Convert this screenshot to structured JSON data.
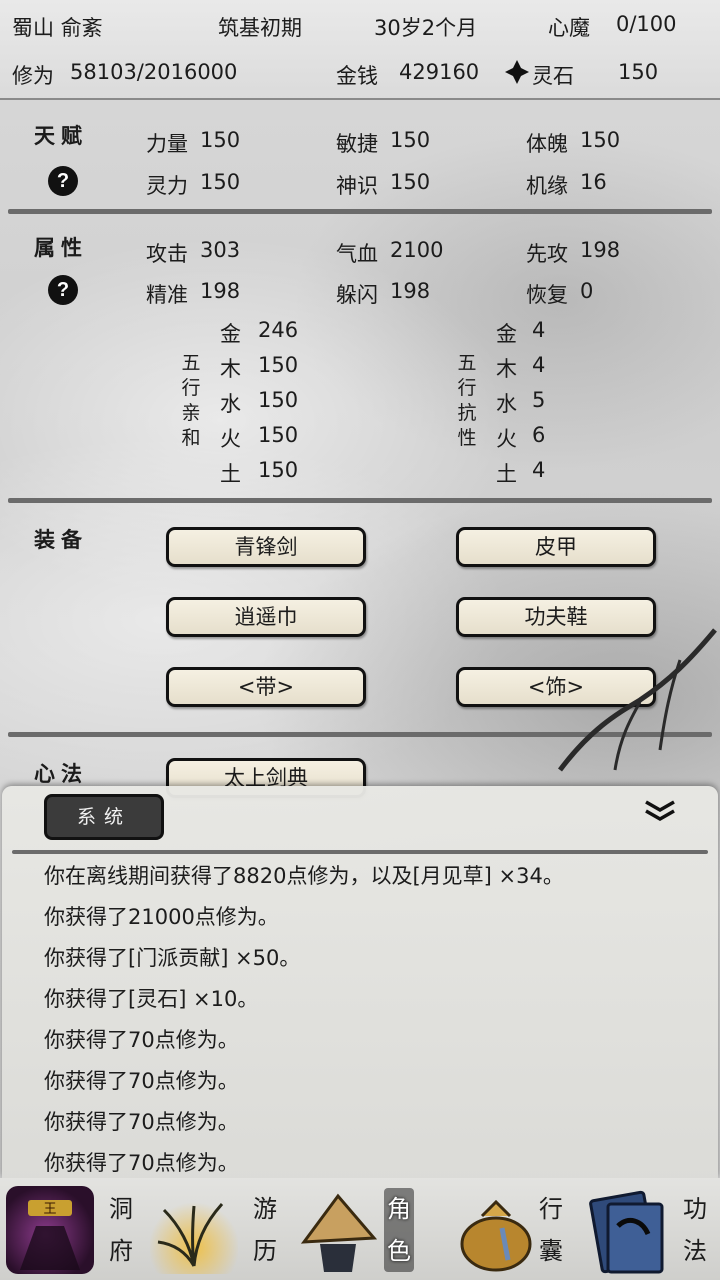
{
  "header": {
    "sect_name": "蜀山 俞紊",
    "realm": "筑基初期",
    "age": "30岁2个月",
    "demon_label": "心魔",
    "demon_value": "0/100",
    "cultivation_label": "修为",
    "cultivation_value": "58103/2016000",
    "money_label": "金钱",
    "money_value": "429160",
    "spirit_stone_label": "灵石",
    "spirit_stone_value": "150"
  },
  "talent": {
    "title": "天赋",
    "help": "?",
    "stats": [
      {
        "label": "力量",
        "value": "150"
      },
      {
        "label": "敏捷",
        "value": "150"
      },
      {
        "label": "体魄",
        "value": "150"
      },
      {
        "label": "灵力",
        "value": "150"
      },
      {
        "label": "神识",
        "value": "150"
      },
      {
        "label": "机缘",
        "value": "16"
      }
    ]
  },
  "attributes": {
    "title": "属性",
    "help": "?",
    "stats": [
      {
        "label": "攻击",
        "value": "303"
      },
      {
        "label": "气血",
        "value": "2100"
      },
      {
        "label": "先攻",
        "value": "198"
      },
      {
        "label": "精准",
        "value": "198"
      },
      {
        "label": "躲闪",
        "value": "198"
      },
      {
        "label": "恢复",
        "value": "0"
      }
    ],
    "affinity_label": "五行亲和",
    "affinity": [
      {
        "el": "金",
        "value": "246"
      },
      {
        "el": "木",
        "value": "150"
      },
      {
        "el": "水",
        "value": "150"
      },
      {
        "el": "火",
        "value": "150"
      },
      {
        "el": "土",
        "value": "150"
      }
    ],
    "resist_label": "五行抗性",
    "resist": [
      {
        "el": "金",
        "value": "4"
      },
      {
        "el": "木",
        "value": "4"
      },
      {
        "el": "水",
        "value": "5"
      },
      {
        "el": "火",
        "value": "6"
      },
      {
        "el": "土",
        "value": "4"
      }
    ]
  },
  "equipment": {
    "title": "装备",
    "slots": [
      "青锋剑",
      "皮甲",
      "逍遥巾",
      "功夫鞋",
      "<带>",
      "<饰>"
    ]
  },
  "methods": {
    "title": "心法",
    "first": "太上剑典"
  },
  "log": {
    "tab_label": "系统",
    "collapse_icon": "double-chevron-down-icon",
    "lines": [
      "你在离线期间获得了8820点修为，以及[月见草] ×34。",
      "你获得了21000点修为。",
      "你获得了[门派贡献] ×50。",
      "你获得了[灵石] ×10。",
      "你获得了70点修为。",
      "你获得了70点修为。",
      "你获得了70点修为。",
      "你获得了70点修为。"
    ]
  },
  "nav": {
    "items": [
      {
        "label": "洞府",
        "icon": "cave-dwelling-icon"
      },
      {
        "label": "游历",
        "icon": "travel-grass-icon"
      },
      {
        "label": "角色",
        "icon": "character-hat-icon"
      },
      {
        "label": "行囊",
        "icon": "bag-icon"
      },
      {
        "label": "功法",
        "icon": "manual-book-icon"
      }
    ]
  }
}
